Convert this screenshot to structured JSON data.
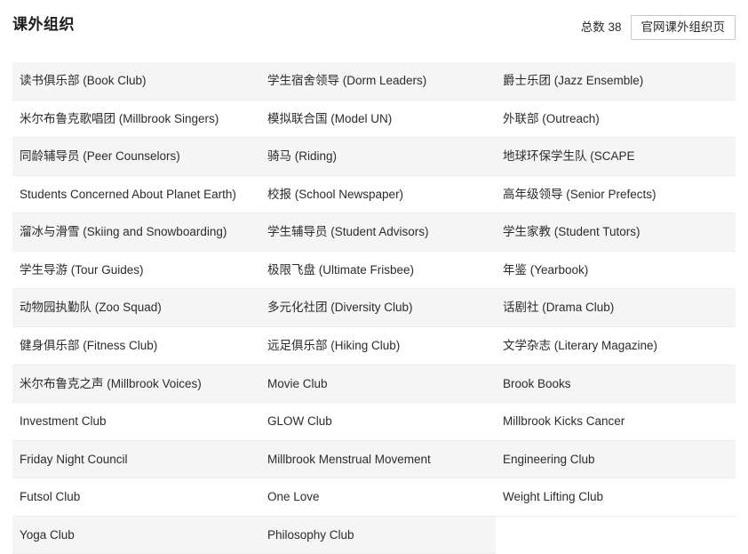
{
  "header": {
    "title": "课外组织",
    "total_label": "总数 38",
    "official_button_label": "官网课外组织页"
  },
  "table": {
    "columns": 3,
    "rows": [
      {
        "striped": true,
        "cells": [
          "读书俱乐部 (Book Club)",
          "学生宿舍领导 (Dorm Leaders)",
          "爵士乐团 (Jazz Ensemble)"
        ]
      },
      {
        "striped": false,
        "cells": [
          "米尔布鲁克歌唱团 (Millbrook Singers)",
          "模拟联合国 (Model UN)",
          "外联部 (Outreach)"
        ]
      },
      {
        "striped": true,
        "cells": [
          "同龄辅导员 (Peer Counselors)",
          "骑马 (Riding)",
          "地球环保学生队 (SCAPE"
        ]
      },
      {
        "striped": false,
        "cells": [
          "Students Concerned About Planet Earth)",
          "校报 (School Newspaper)",
          "高年级领导 (Senior Prefects)"
        ]
      },
      {
        "striped": true,
        "cells": [
          "溜冰与滑雪 (Skiing and Snowboarding)",
          "学生辅导员 (Student Advisors)",
          "学生家教 (Student Tutors)"
        ]
      },
      {
        "striped": false,
        "cells": [
          "学生导游 (Tour Guides)",
          "极限飞盘 (Ultimate Frisbee)",
          "年鉴 (Yearbook)"
        ]
      },
      {
        "striped": true,
        "cells": [
          "动物园执勤队 (Zoo Squad)",
          "多元化社团 (Diversity Club)",
          "话剧社 (Drama Club)"
        ]
      },
      {
        "striped": false,
        "cells": [
          "健身俱乐部 (Fitness Club)",
          "远足俱乐部 (Hiking Club)",
          "文学杂志 (Literary Magazine)"
        ]
      },
      {
        "striped": true,
        "cells": [
          "米尔布鲁克之声 (Millbrook Voices)",
          "Movie Club",
          "Brook Books"
        ]
      },
      {
        "striped": false,
        "cells": [
          "Investment Club",
          "GLOW Club",
          "Millbrook Kicks Cancer"
        ]
      },
      {
        "striped": true,
        "cells": [
          "Friday Night Council",
          "Millbrook Menstrual Movement",
          "Engineering Club"
        ]
      },
      {
        "striped": false,
        "cells": [
          "Futsol Club",
          "One Love",
          "Weight Lifting Club"
        ]
      },
      {
        "striped": true,
        "cells": [
          "Yoga Club",
          "Philosophy Club",
          ""
        ]
      }
    ]
  },
  "colors": {
    "stripe": "#f5f5f5",
    "row_border": "#eceff1",
    "text": "#2b2b2b",
    "title": "#1d1d1d",
    "button_border": "#c8c8c8",
    "background": "#ffffff"
  }
}
